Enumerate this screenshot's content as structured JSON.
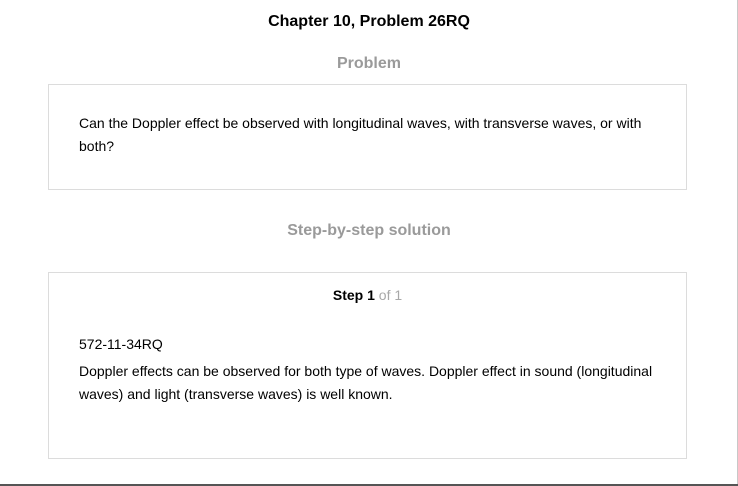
{
  "header": {
    "title": "Chapter 10, Problem 26RQ"
  },
  "problem": {
    "heading": "Problem",
    "text": "Can the Doppler effect be observed with longitudinal waves, with transverse waves, or with both?"
  },
  "solution": {
    "heading": "Step-by-step solution",
    "step": {
      "label": "Step",
      "number": "1",
      "of_text": "of 1",
      "reference": "572-11-34RQ",
      "text": "Doppler effects can be observed for both type of waves. Doppler effect in sound (longitudinal waves) and light (transverse waves) is well known."
    }
  }
}
